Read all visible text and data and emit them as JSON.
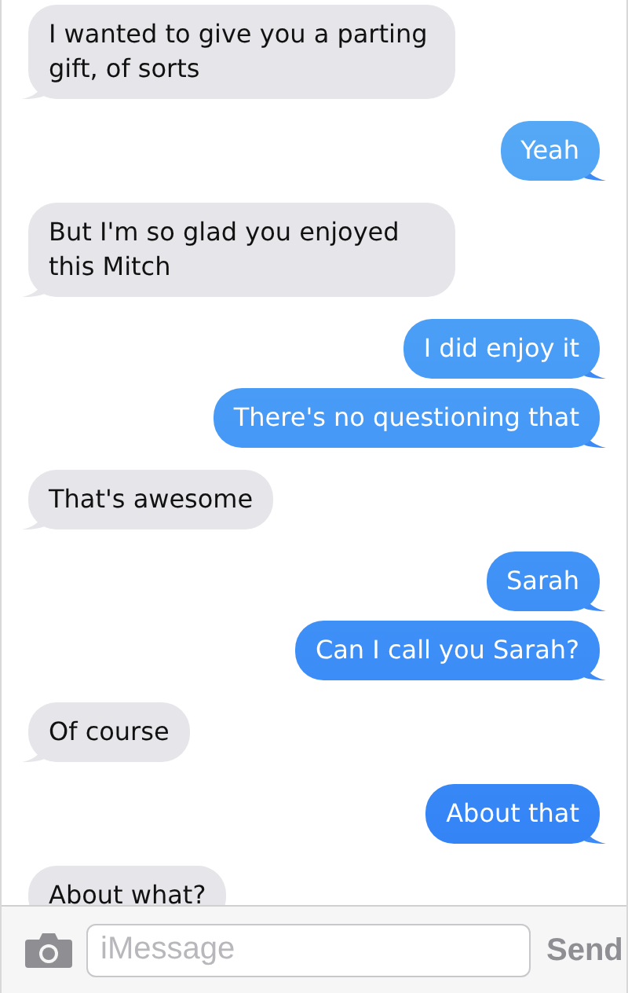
{
  "messages": [
    {
      "kind": "received",
      "text": "I wanted to give you a parting gift, of sorts"
    },
    {
      "kind": "sent",
      "text": "Yeah"
    },
    {
      "kind": "received",
      "text": "But I'm so glad you enjoyed this Mitch"
    },
    {
      "kind": "sent",
      "text": "I did enjoy it"
    },
    {
      "kind": "sent",
      "text": "There's no questioning that"
    },
    {
      "kind": "received",
      "text": "That's awesome"
    },
    {
      "kind": "sent",
      "text": "Sarah"
    },
    {
      "kind": "sent",
      "text": "Can I call you Sarah?"
    },
    {
      "kind": "received",
      "text": "Of course"
    },
    {
      "kind": "sent",
      "text": "About that"
    },
    {
      "kind": "received",
      "text": "About what?"
    }
  ],
  "composer": {
    "placeholder": "iMessage",
    "send": "Send"
  }
}
